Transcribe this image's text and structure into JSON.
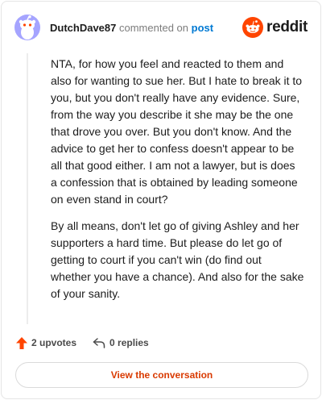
{
  "header": {
    "username": "DutchDave87",
    "action_text": "commented on",
    "post_link": "post",
    "logo_text": "reddit"
  },
  "comment": {
    "paragraphs": [
      "NTA, for how you feel and reacted to them and also for wanting to sue her. But I hate to break it to you, but you don't really have any evidence. Sure, from the way you describe it she may be the one that drove you over. But you don't know. And the advice to get her to confess doesn't appear to be all that good either. I am not a lawyer, but is does a confession that is obtained by leading someone on even stand in court?",
      "By all means, don't let go of giving Ashley and her supporters a hard time. But please do let go of getting to court if you can't win (do find out whether you have a chance). And also for the sake of your sanity."
    ]
  },
  "footer": {
    "upvotes": "2 upvotes",
    "replies": "0 replies",
    "view_button": "View the conversation"
  },
  "icons": {
    "upvote": "upvote-arrow-icon",
    "reply": "reply-arrow-icon",
    "avatar": "snoo-avatar-icon",
    "logo": "reddit-logo-icon"
  },
  "colors": {
    "upvote": "#ff4500",
    "link": "#0079d3",
    "button_text": "#d93a00",
    "avatar_bg": "#a5a4ff",
    "brand": "#ff4500"
  }
}
